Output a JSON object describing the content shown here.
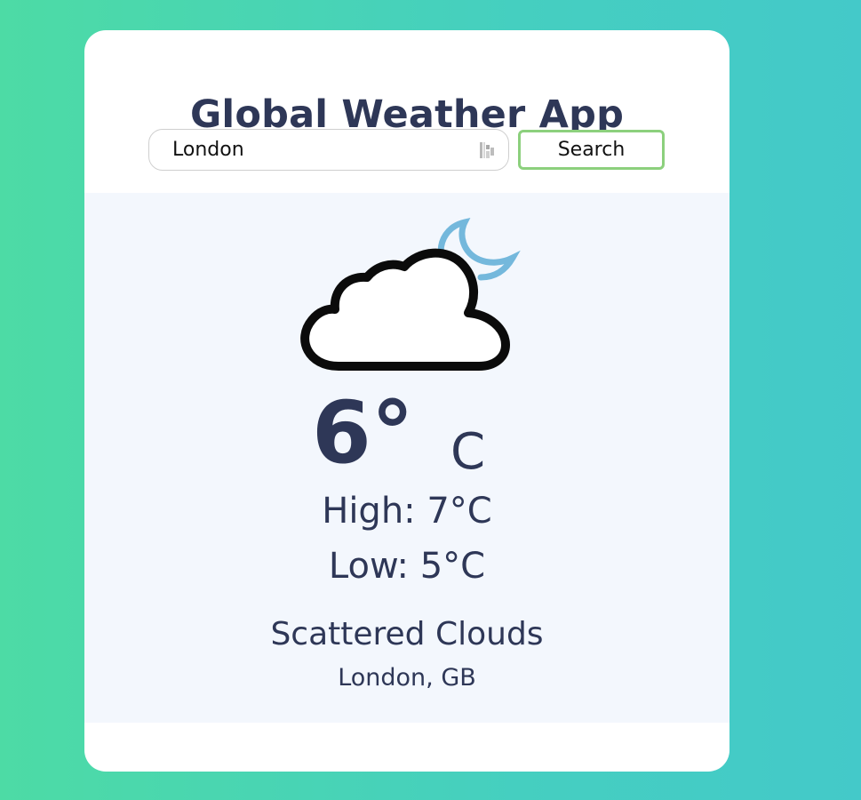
{
  "app": {
    "title": "Global Weather App"
  },
  "search": {
    "value": "London",
    "button_label": "Search",
    "autofill_icon": "contact-card-icon"
  },
  "weather": {
    "icon": "cloud-moon-icon",
    "temperature": "6°",
    "unit": "C",
    "high": "High: 7°C",
    "low": "Low: 5°C",
    "description": "Scattered Clouds",
    "location": "London, GB"
  },
  "colors": {
    "text_primary": "#2e3757",
    "button_border": "#8cd07d",
    "panel_background": "#f3f7fd",
    "moon": "#74b8dc",
    "background_gradient_start": "#4ddba5",
    "background_gradient_end": "#44c9c9"
  }
}
